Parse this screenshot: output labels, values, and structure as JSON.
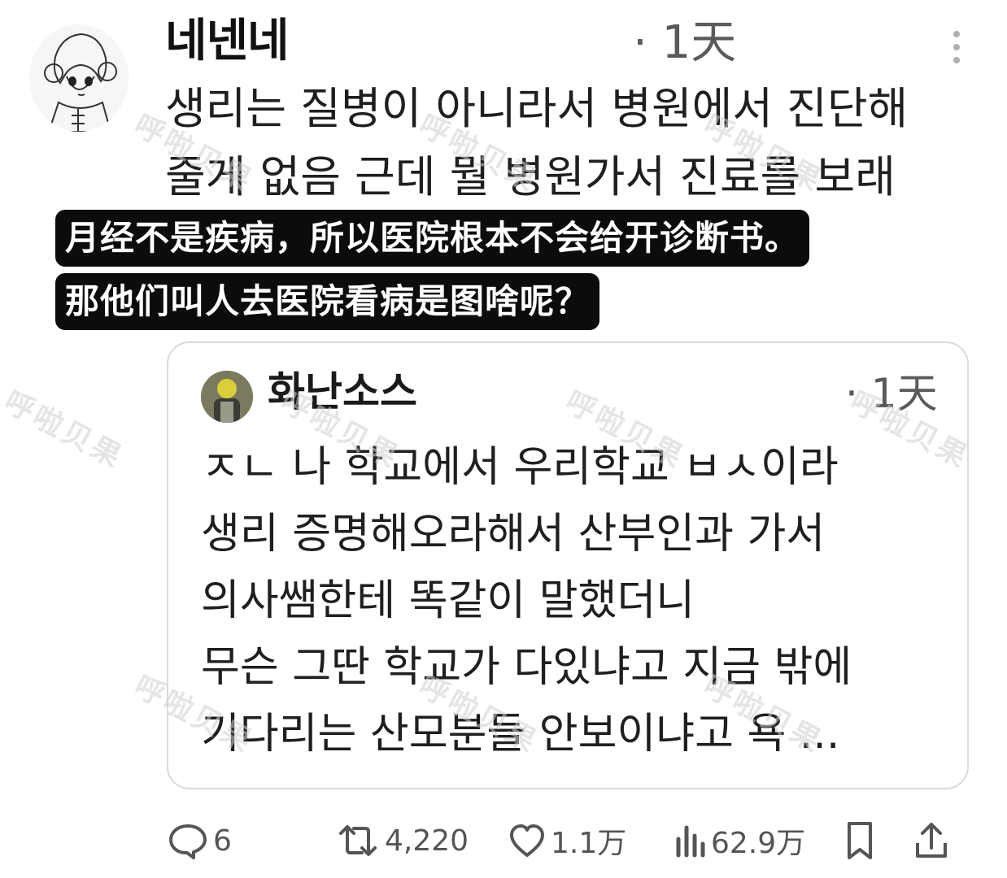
{
  "tweet": {
    "author_name": "네넨네",
    "time": "· 1天",
    "text_lines": [
      "생리는 질병이 아니라서 병원에서 진단해",
      "줄게 없음 근데 뭘 병원가서 진료를 보래"
    ]
  },
  "translation": {
    "lines": [
      "月经不是疾病，所以医院根本不会给开诊断书。",
      "那他们叫人去医院看病是图啥呢？"
    ]
  },
  "quote": {
    "author_name": "화난소스",
    "time": "· 1天",
    "text_lines": [
      "ㅈㄴ 나 학교에서 우리학교 ㅂㅅ이라",
      "생리 증명해오라해서 산부인과 가서",
      "의사쌤한테 똑같이 말했더니",
      "무슨 그딴 학교가 다있냐고 지금 밖에",
      "기다리는 산모분들 안보이냐고 욕 ..."
    ]
  },
  "actions": {
    "replies": "6",
    "retweets": "4,220",
    "likes": "1.1万",
    "views": "62.9万"
  },
  "watermark": {
    "text": "呼啦贝果"
  },
  "icons": {
    "more": "more-vertical-icon",
    "reply": "speech-bubble-icon",
    "retweet": "retweet-icon",
    "like": "heart-icon",
    "views": "bar-chart-icon",
    "bookmark": "bookmark-icon",
    "share": "share-icon"
  },
  "colors": {
    "icon_gray": "#555555",
    "text": "#1f1f1f",
    "translation_bg": "#0c0c0c",
    "card_border": "#dadada"
  }
}
